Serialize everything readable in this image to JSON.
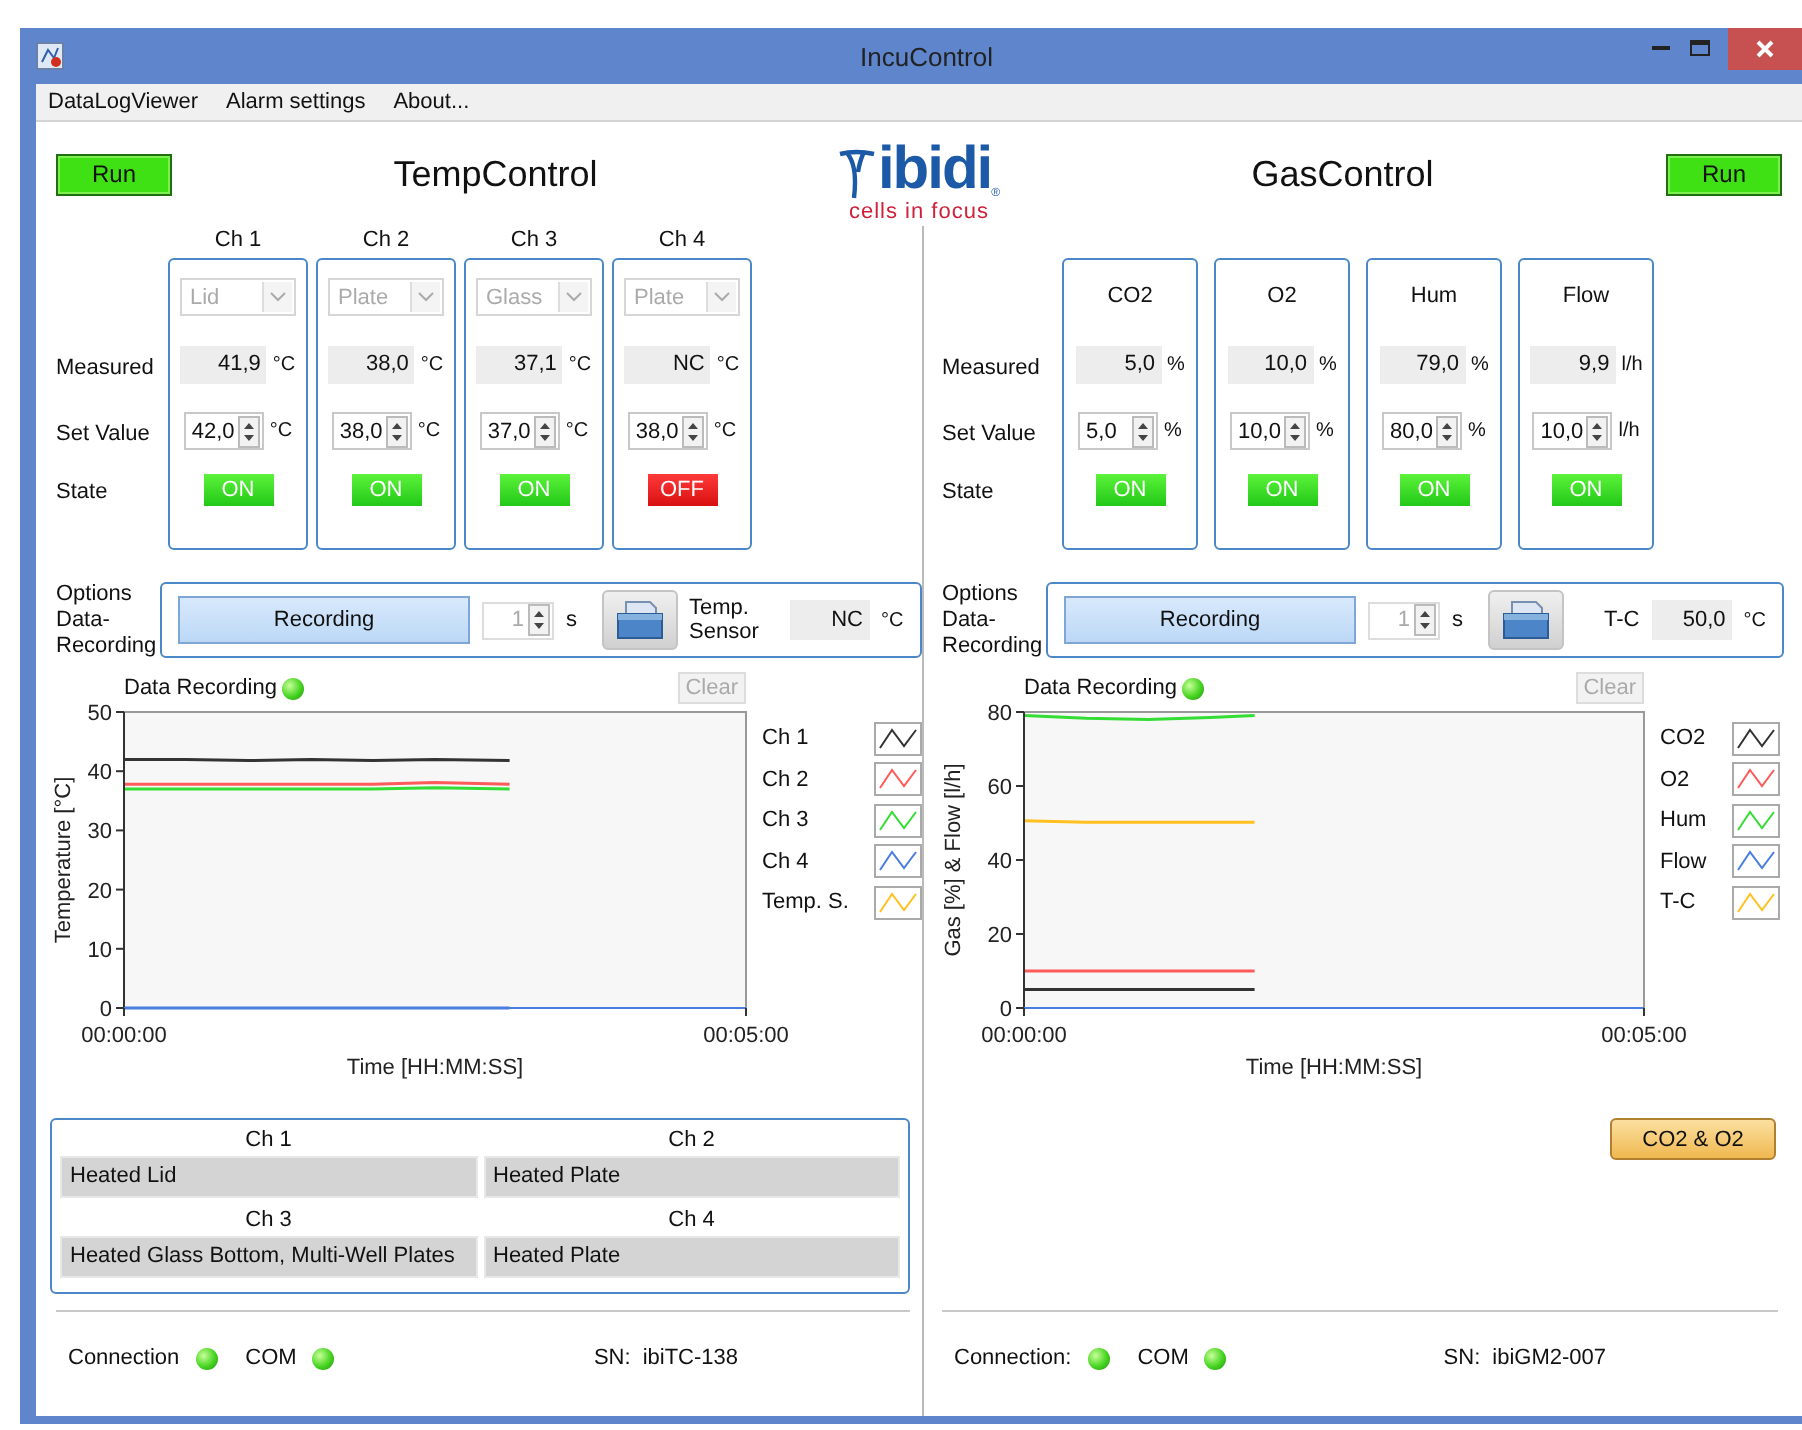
{
  "window": {
    "title": "IncuControl"
  },
  "menu": [
    "DataLogViewer",
    "Alarm settings",
    "About..."
  ],
  "logo": {
    "name": "ibidi",
    "registered": "®",
    "tagline": "cells in focus"
  },
  "temp_control": {
    "title": "TempControl",
    "run_button": "Run",
    "row_labels": [
      "Measured",
      "Set Value",
      "State"
    ],
    "channels": [
      {
        "name": "Ch 1",
        "mode": "Lid",
        "mode_disabled": true,
        "measured": "41,9",
        "measured_unit": "°C",
        "set_value": "42,0",
        "set_unit": "°C",
        "state": "ON",
        "on": true
      },
      {
        "name": "Ch 2",
        "mode": "Plate",
        "mode_disabled": true,
        "measured": "38,0",
        "measured_unit": "°C",
        "set_value": "38,0",
        "set_unit": "°C",
        "state": "ON",
        "on": true
      },
      {
        "name": "Ch 3",
        "mode": "Glass",
        "mode_disabled": true,
        "measured": "37,1",
        "measured_unit": "°C",
        "set_value": "37,0",
        "set_unit": "°C",
        "state": "ON",
        "on": true
      },
      {
        "name": "Ch 4",
        "mode": "Plate",
        "mode_disabled": true,
        "measured": "NC",
        "measured_unit": "°C",
        "set_value": "38,0",
        "set_unit": "°C",
        "state": "OFF",
        "on": false
      }
    ],
    "options": {
      "label": "Options Data-Recording",
      "recording_button": "Recording",
      "interval": "1",
      "interval_disabled": true,
      "interval_unit": "s",
      "reading_label": "Temp. Sensor",
      "reading_value": "NC",
      "reading_unit": "°C"
    },
    "recording": {
      "status_label": "Data Recording",
      "status_on": true,
      "clear_button": "Clear",
      "clear_disabled": true,
      "chart_data": {
        "type": "line",
        "xlabel": "Time [HH:MM:SS]",
        "ylabel": "Temperature [°C]",
        "x": [
          0,
          0.5,
          1,
          1.5,
          2,
          2.5,
          3.1
        ],
        "xlim": [
          0,
          5
        ],
        "ylim": [
          0,
          50
        ],
        "xticks": [
          {
            "value": 0,
            "label": "00:00:00"
          },
          {
            "value": 5,
            "label": "00:05:00"
          }
        ],
        "yticks": [
          0,
          10,
          20,
          30,
          40,
          50
        ],
        "series": [
          {
            "name": "Ch 1",
            "color": "#333333",
            "values": [
              42,
              42,
              41.8,
              42,
              41.8,
              42,
              41.8
            ]
          },
          {
            "name": "Ch 2",
            "color": "#ff5a5a",
            "values": [
              37.8,
              37.8,
              37.8,
              37.8,
              37.8,
              38.1,
              37.8
            ]
          },
          {
            "name": "Ch 3",
            "color": "#33dd33",
            "values": [
              37,
              37,
              37,
              37,
              37,
              37.2,
              37
            ]
          },
          {
            "name": "Ch 4",
            "color": "#4a7de0",
            "values": [
              0,
              0,
              0,
              0,
              0,
              0,
              0
            ]
          },
          {
            "name": "Temp. S.",
            "color": "#ffc020",
            "values": [
              null,
              null,
              null,
              null,
              null,
              null,
              null
            ]
          }
        ]
      }
    },
    "channel_info": [
      {
        "name": "Ch 1",
        "description": "Heated Lid"
      },
      {
        "name": "Ch 2",
        "description": "Heated Plate"
      },
      {
        "name": "Ch 3",
        "description": "Heated Glass Bottom, Multi-Well Plates"
      },
      {
        "name": "Ch 4",
        "description": "Heated Plate"
      }
    ],
    "status": {
      "connection_label": "Connection",
      "connection_on": true,
      "com_label": "COM",
      "com_on": true,
      "serial_label": "SN:",
      "serial": "ibiTC-138"
    }
  },
  "gas_control": {
    "title": "GasControl",
    "run_button": "Run",
    "row_labels": [
      "Measured",
      "Set Value",
      "State"
    ],
    "channels": [
      {
        "name": "CO2",
        "measured": "5,0",
        "measured_unit": "%",
        "set_value": "5,0",
        "set_unit": "%",
        "state": "ON",
        "on": true
      },
      {
        "name": "O2",
        "measured": "10,0",
        "measured_unit": "%",
        "set_value": "10,0",
        "set_unit": "%",
        "state": "ON",
        "on": true
      },
      {
        "name": "Hum",
        "measured": "79,0",
        "measured_unit": "%",
        "set_value": "80,0",
        "set_unit": "%",
        "state": "ON",
        "on": true
      },
      {
        "name": "Flow",
        "measured": "9,9",
        "measured_unit": "l/h",
        "set_value": "10,0",
        "set_unit": "l/h",
        "state": "ON",
        "on": true
      }
    ],
    "options": {
      "label": "Options Data-Recording",
      "recording_button": "Recording",
      "interval": "1",
      "interval_disabled": true,
      "interval_unit": "s",
      "reading_label": "T-C",
      "reading_value": "50,0",
      "reading_unit": "°C"
    },
    "recording": {
      "status_label": "Data Recording",
      "status_on": true,
      "clear_button": "Clear",
      "clear_disabled": true,
      "chart_data": {
        "type": "line",
        "xlabel": "Time [HH:MM:SS]",
        "ylabel": "Gas [%] & Flow [l/h]",
        "x": [
          0,
          0.5,
          1,
          1.5,
          1.86
        ],
        "xlim": [
          0,
          5
        ],
        "ylim": [
          0,
          80
        ],
        "xticks": [
          {
            "value": 0,
            "label": "00:00:00"
          },
          {
            "value": 5,
            "label": "00:05:00"
          }
        ],
        "yticks": [
          0,
          20,
          40,
          60,
          80
        ],
        "series": [
          {
            "name": "CO2",
            "color": "#333333",
            "values": [
              5,
              5,
              5,
              5,
              5
            ]
          },
          {
            "name": "O2",
            "color": "#ff5a5a",
            "values": [
              10,
              10,
              10,
              10,
              10
            ]
          },
          {
            "name": "Hum",
            "color": "#33dd33",
            "values": [
              79,
              78.3,
              78,
              78.5,
              79
            ]
          },
          {
            "name": "Flow",
            "color": "#4a7de0",
            "values": [
              null,
              null,
              null,
              null,
              null
            ]
          },
          {
            "name": "T-C",
            "color": "#ffc020",
            "values": [
              50.6,
              50.2,
              50.2,
              50.2,
              50.2
            ]
          }
        ]
      }
    },
    "preset_button": "CO2 & O2",
    "status": {
      "connection_label": "Connection:",
      "connection_on": true,
      "com_label": "COM",
      "com_on": true,
      "serial_label": "SN:",
      "serial": "ibiGM2-007"
    }
  }
}
